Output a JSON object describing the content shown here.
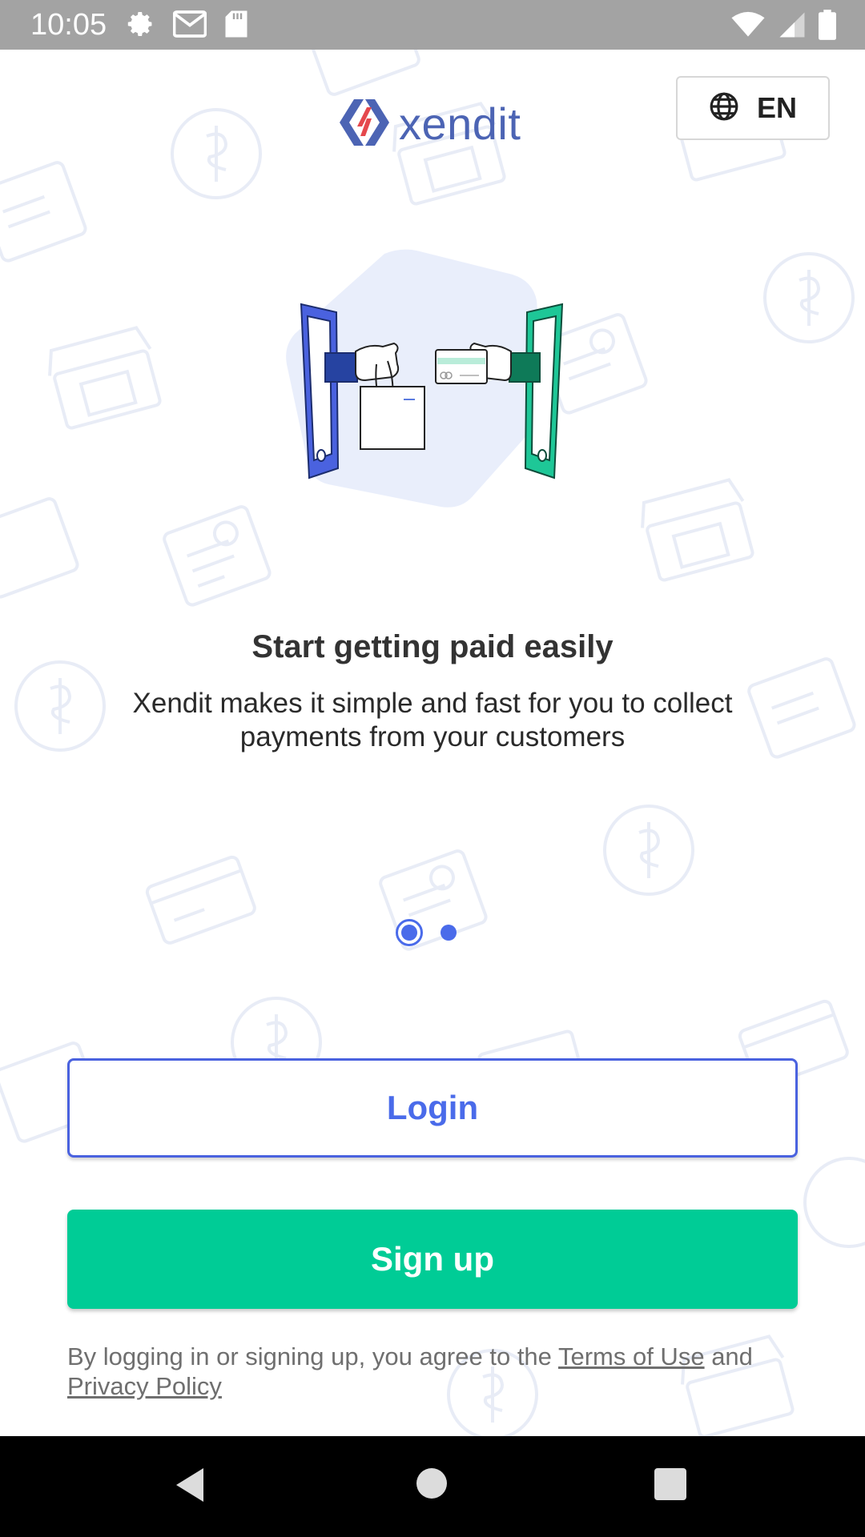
{
  "status_bar": {
    "time": "10:05",
    "left_icons": [
      "settings-icon",
      "gmail-icon",
      "sd-card-icon"
    ],
    "right_icons": [
      "wifi-icon",
      "signal-icon",
      "battery-icon"
    ]
  },
  "header": {
    "logo_text": "xendit",
    "language_label": "EN",
    "language_icon": "globe-icon"
  },
  "onboarding": {
    "title": "Start getting paid easily",
    "description": "Xendit makes it simple and fast for you to collect payments from your customers",
    "page_count": 2,
    "current_page": 1
  },
  "actions": {
    "login_label": "Login",
    "signup_label": "Sign up"
  },
  "legal": {
    "prefix": "By logging in or signing up, you agree to the ",
    "terms_label": "Terms of Use",
    "middle": " and ",
    "privacy_label": "Privacy Policy"
  },
  "colors": {
    "primary_blue": "#4a6bea",
    "signup_green": "#00cc96",
    "logo_red": "#e5484d",
    "status_bar": "#a3a3a3",
    "nav_bar": "#000000"
  },
  "nav_bar": {
    "buttons": [
      "back-icon",
      "home-icon",
      "recents-icon"
    ]
  }
}
